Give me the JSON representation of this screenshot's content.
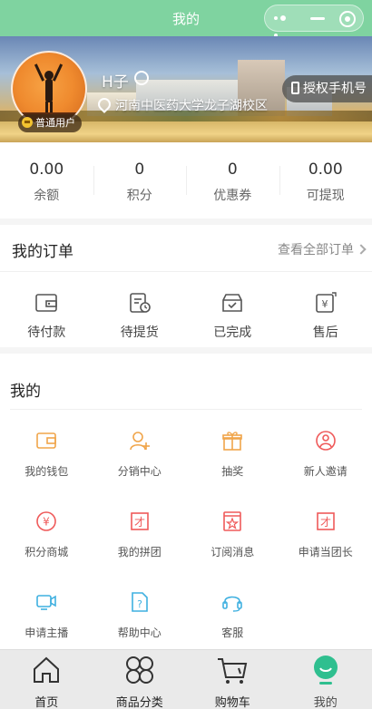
{
  "titlebar": {
    "title": "我的"
  },
  "profile": {
    "username": "H子",
    "level": "普通用户",
    "location": "河南中医药大学龙子湖校区",
    "auth_button": "授权手机号"
  },
  "stats": [
    {
      "value": "0.00",
      "label": "余额"
    },
    {
      "value": "0",
      "label": "积分"
    },
    {
      "value": "0",
      "label": "优惠券"
    },
    {
      "value": "0.00",
      "label": "可提现"
    }
  ],
  "orders": {
    "title": "我的订单",
    "view_all": "查看全部订单",
    "items": [
      {
        "label": "待付款",
        "icon": "wallet-icon"
      },
      {
        "label": "待提货",
        "icon": "pickup-icon"
      },
      {
        "label": "已完成",
        "icon": "box-check-icon"
      },
      {
        "label": "售后",
        "icon": "aftersale-icon"
      }
    ]
  },
  "mine": {
    "title": "我的",
    "items": [
      {
        "label": "我的钱包",
        "icon": "wallet-icon",
        "color": "#f0a54a"
      },
      {
        "label": "分销中心",
        "icon": "user-add-icon",
        "color": "#f0a54a"
      },
      {
        "label": "抽奖",
        "icon": "gift-icon",
        "color": "#f0a54a"
      },
      {
        "label": "新人邀请",
        "icon": "user-circle-icon",
        "color": "#ef5a5a"
      },
      {
        "label": "积分商城",
        "icon": "yen-circle-icon",
        "color": "#ef5a5a"
      },
      {
        "label": "我的拼团",
        "icon": "group-icon",
        "color": "#ef5a5a"
      },
      {
        "label": "订阅消息",
        "icon": "star-doc-icon",
        "color": "#ef5a5a"
      },
      {
        "label": "申请当团长",
        "icon": "leader-icon",
        "color": "#ef5a5a"
      },
      {
        "label": "申请主播",
        "icon": "video-icon",
        "color": "#3fb0e0"
      },
      {
        "label": "帮助中心",
        "icon": "help-doc-icon",
        "color": "#3fb0e0"
      },
      {
        "label": "客服",
        "icon": "headset-icon",
        "color": "#3fb0e0"
      }
    ]
  },
  "tabbar": {
    "items": [
      {
        "label": "首页",
        "icon": "home-icon"
      },
      {
        "label": "商品分类",
        "icon": "category-icon"
      },
      {
        "label": "购物车",
        "icon": "cart-icon"
      },
      {
        "label": "我的",
        "icon": "profile-icon"
      }
    ],
    "active_color": "#2fbf8f"
  }
}
